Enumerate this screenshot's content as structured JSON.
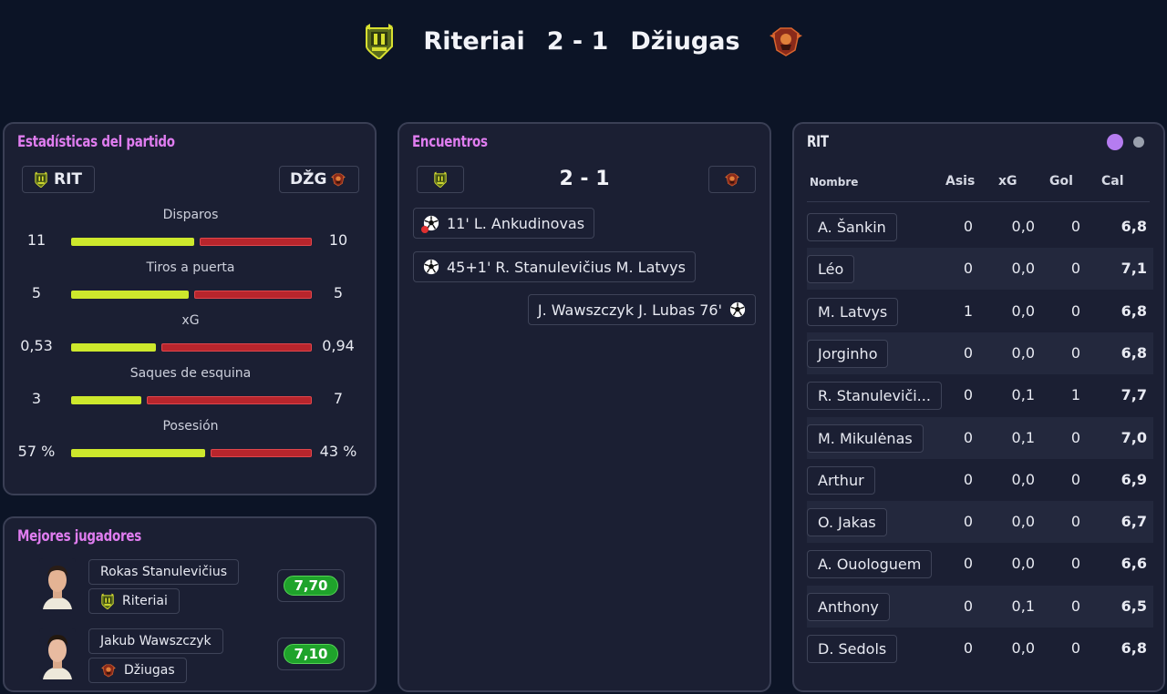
{
  "match": {
    "home_team": "Riteriai",
    "away_team": "Džiugas",
    "score": "2 - 1",
    "home_crest": "riteriai-crest-icon",
    "away_crest": "dziugas-crest-icon"
  },
  "stats_panel": {
    "title": "Estadísticas del partido",
    "home_abbr": "RIT",
    "away_abbr": "DŽG",
    "stats": [
      {
        "label": "Disparos",
        "home": "11",
        "away": "10",
        "home_value": 11,
        "away_value": 10
      },
      {
        "label": "Tiros a puerta",
        "home": "5",
        "away": "5",
        "home_value": 5,
        "away_value": 5
      },
      {
        "label": "xG",
        "home": "0,53",
        "away": "0,94",
        "home_value": 0.53,
        "away_value": 0.94
      },
      {
        "label": "Saques de esquina",
        "home": "3",
        "away": "7",
        "home_value": 3,
        "away_value": 7
      },
      {
        "label": "Posesión",
        "home": "57 %",
        "away": "43 %",
        "home_value": 57,
        "away_value": 43
      }
    ]
  },
  "best_players": {
    "title": "Mejores jugadores",
    "players": [
      {
        "name": "Rokas Stanulevičius",
        "team": "Riteriai",
        "rating": "7,70"
      },
      {
        "name": "Jakub Wawszczyk",
        "team": "Džiugas",
        "rating": "7,10"
      }
    ]
  },
  "events": {
    "title": "Encuentros",
    "score": "2 - 1",
    "items": [
      {
        "side": "home",
        "text": "11' L. Ankudinovas",
        "icon": "own-goal-ball-icon"
      },
      {
        "side": "home",
        "text": "45+1' R. Stanulevičius M. Latvys",
        "icon": "soccer-ball-icon"
      },
      {
        "side": "away",
        "text": "J. Wawszczyk J. Lubas 76'",
        "icon": "soccer-ball-icon"
      }
    ]
  },
  "lineup": {
    "title": "RIT",
    "columns": {
      "name": "Nombre",
      "assists": "Asis",
      "xg": "xG",
      "goals": "Gol",
      "rating": "Cal"
    },
    "pager": {
      "active_color": "#b57cf0",
      "inactive_color": "#9aa0ad"
    },
    "rows": [
      {
        "name": "A. Šankin",
        "assists": "0",
        "xg": "0,0",
        "goals": "0",
        "rating": "6,8"
      },
      {
        "name": "Léo",
        "assists": "0",
        "xg": "0,0",
        "goals": "0",
        "rating": "7,1"
      },
      {
        "name": "M. Latvys",
        "assists": "1",
        "xg": "0,0",
        "goals": "0",
        "rating": "6,8"
      },
      {
        "name": "Jorginho",
        "assists": "0",
        "xg": "0,0",
        "goals": "0",
        "rating": "6,8"
      },
      {
        "name": "R. Stanuleviči...",
        "assists": "0",
        "xg": "0,1",
        "goals": "1",
        "rating": "7,7"
      },
      {
        "name": "M. Mikulėnas",
        "assists": "0",
        "xg": "0,1",
        "goals": "0",
        "rating": "7,0"
      },
      {
        "name": "Arthur",
        "assists": "0",
        "xg": "0,0",
        "goals": "0",
        "rating": "6,9"
      },
      {
        "name": "O. Jakas",
        "assists": "0",
        "xg": "0,0",
        "goals": "0",
        "rating": "6,7"
      },
      {
        "name": "A. Ouologuem",
        "assists": "0",
        "xg": "0,0",
        "goals": "0",
        "rating": "6,6"
      },
      {
        "name": "Anthony",
        "assists": "0",
        "xg": "0,1",
        "goals": "0",
        "rating": "6,5"
      },
      {
        "name": "D. Sedols",
        "assists": "0",
        "xg": "0,0",
        "goals": "0",
        "rating": "6,8"
      }
    ]
  },
  "colors": {
    "accent": "#e07df0",
    "home_bar": "#cde82c",
    "away_bar": "#b8252c",
    "rating_green": "#1fa32b"
  }
}
